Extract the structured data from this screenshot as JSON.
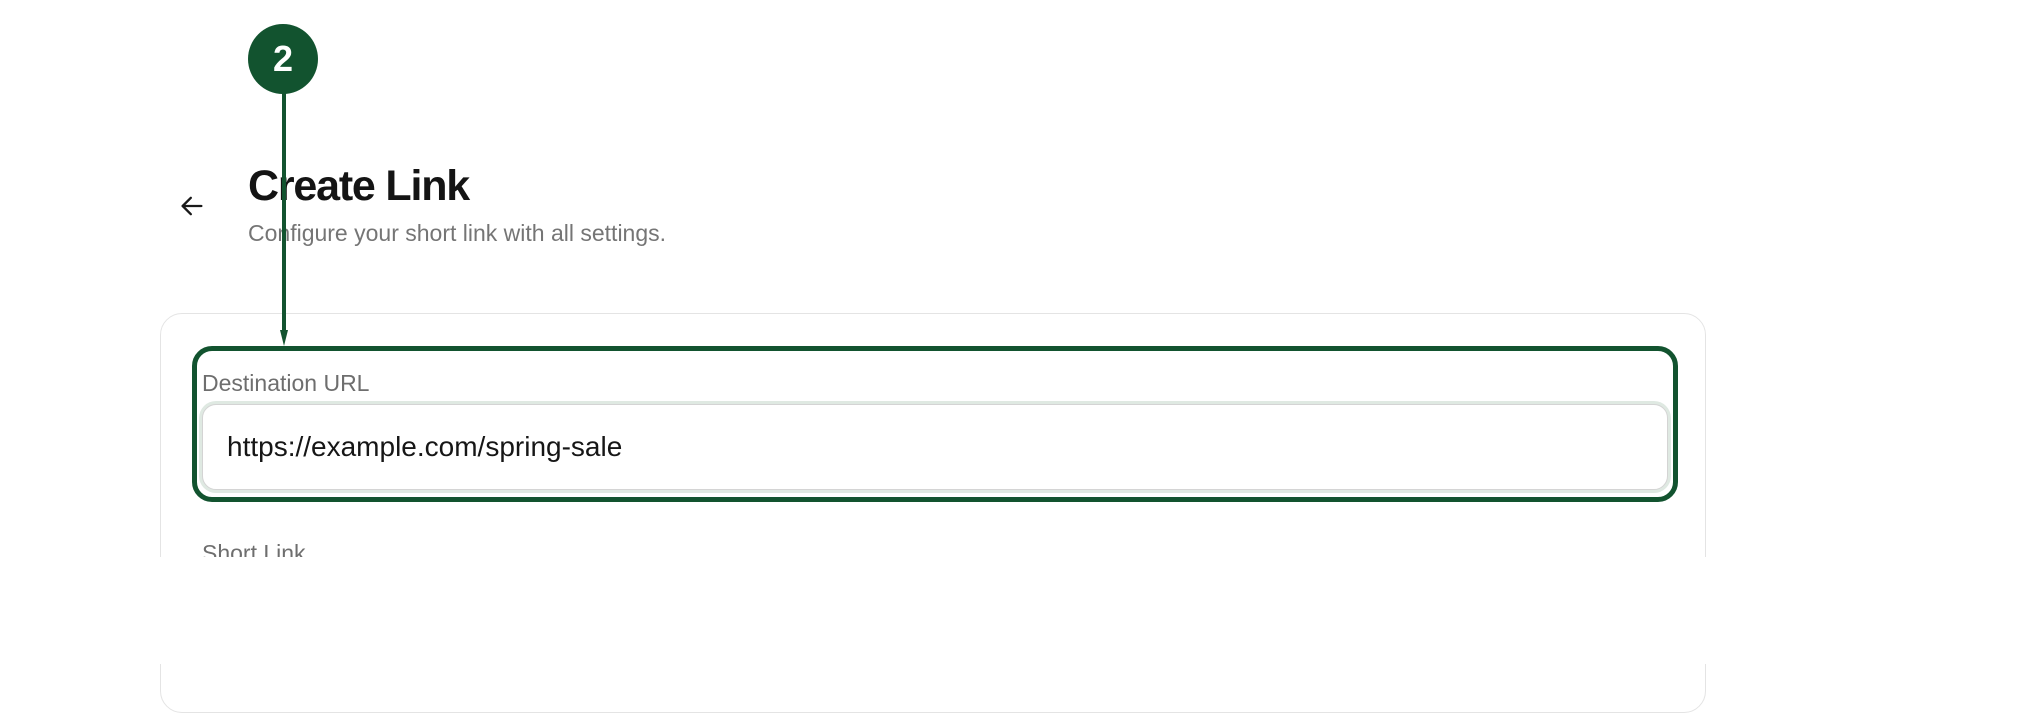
{
  "header": {
    "back_icon": "arrow-left-icon",
    "title": "Create Link",
    "subtitle": "Configure your short link with all settings."
  },
  "form": {
    "destination_label": "Destination URL",
    "destination_value": "https://example.com/spring-sale",
    "short_link_label": "Short Link"
  },
  "annotation": {
    "step_number": "2",
    "color": "#12532f"
  }
}
